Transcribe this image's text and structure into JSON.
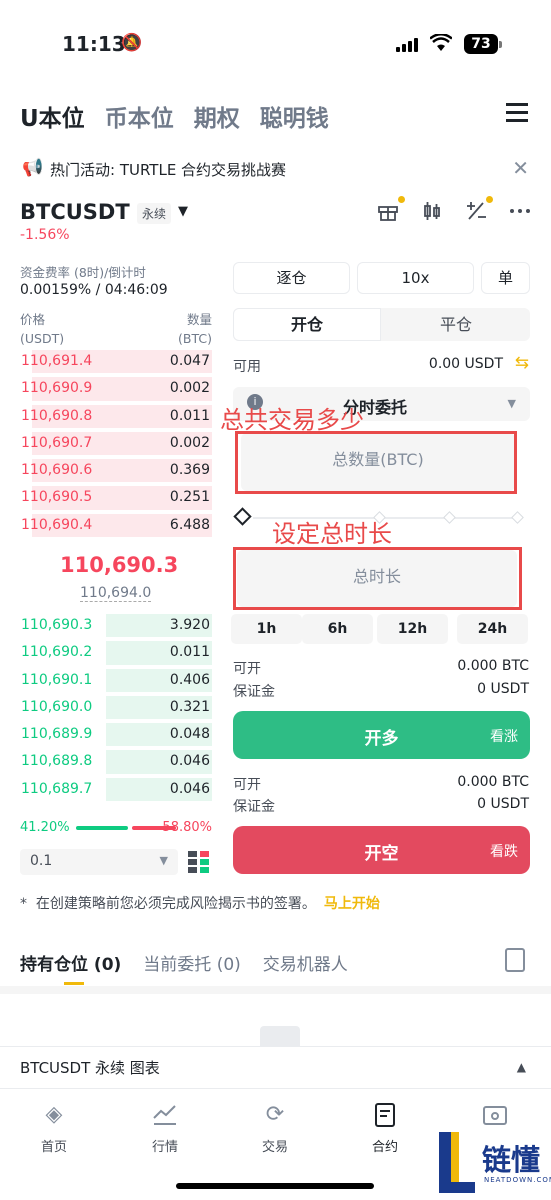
{
  "status": {
    "time": "11:13",
    "battery": "73"
  },
  "top_tabs": [
    "U本位",
    "币本位",
    "期权",
    "聪明钱"
  ],
  "banner": {
    "text": "热门活动: TURTLE 合约交易挑战赛"
  },
  "symbol": {
    "name": "BTCUSDT",
    "type": "永续",
    "change": "-1.56%"
  },
  "funding": {
    "label": "资金费率 (8时)/倒计时",
    "value": "0.00159% / 04:46:09"
  },
  "orderbook": {
    "price_header": [
      "价格",
      "(USDT)"
    ],
    "qty_header": [
      "数量",
      "(BTC)"
    ],
    "asks": [
      {
        "price": "110,691.4",
        "qty": "0.047",
        "depth": 0.85
      },
      {
        "price": "110,690.9",
        "qty": "0.002",
        "depth": 0.85
      },
      {
        "price": "110,690.8",
        "qty": "0.011",
        "depth": 0.85
      },
      {
        "price": "110,690.7",
        "qty": "0.002",
        "depth": 0.85
      },
      {
        "price": "110,690.6",
        "qty": "0.369",
        "depth": 0.85
      },
      {
        "price": "110,690.5",
        "qty": "0.251",
        "depth": 0.85
      },
      {
        "price": "110,690.4",
        "qty": "6.488",
        "depth": 0.85
      }
    ],
    "last_price": "110,690.3",
    "mark_price": "110,694.0",
    "bids": [
      {
        "price": "110,690.3",
        "qty": "3.920",
        "depth": 0.5
      },
      {
        "price": "110,690.2",
        "qty": "0.011",
        "depth": 0.5
      },
      {
        "price": "110,690.1",
        "qty": "0.406",
        "depth": 0.5
      },
      {
        "price": "110,690.0",
        "qty": "0.321",
        "depth": 0.5
      },
      {
        "price": "110,689.9",
        "qty": "0.048",
        "depth": 0.5
      },
      {
        "price": "110,689.8",
        "qty": "0.046",
        "depth": 0.5
      },
      {
        "price": "110,689.7",
        "qty": "0.046",
        "depth": 0.5
      }
    ],
    "buy_ratio": "41.20%",
    "sell_ratio": "58.80%",
    "step": "0.1"
  },
  "form": {
    "margin_mode": "逐仓",
    "leverage": "10x",
    "position_mode": "单",
    "open_label": "开仓",
    "close_label": "平仓",
    "available_label": "可用",
    "available_value": "0.00 USDT",
    "order_type": "分时委托",
    "total_qty_placeholder": "总数量(BTC)",
    "total_time_placeholder": "总时长",
    "durations": [
      "1h",
      "6h",
      "12h",
      "24h"
    ],
    "long": {
      "can_open_label": "可开",
      "can_open_value": "0.000 BTC",
      "margin_label": "保证金",
      "margin_value": "0 USDT",
      "button": "开多",
      "sub": "看涨"
    },
    "short": {
      "can_open_label": "可开",
      "can_open_value": "0.000 BTC",
      "margin_label": "保证金",
      "margin_value": "0 USDT",
      "button": "开空",
      "sub": "看跌"
    }
  },
  "annotations": {
    "a1": "总共交易多少",
    "a2": "设定总时长"
  },
  "note": {
    "text": "在创建策略前您必须完成风险揭示书的签署。",
    "link": "马上开始"
  },
  "bottom_tabs": [
    "持有仓位 (0)",
    "当前委托 (0)",
    "交易机器人"
  ],
  "chart_bar": "BTCUSDT 永续  图表",
  "nav": [
    "首页",
    "行情",
    "交易",
    "合约",
    ""
  ],
  "watermark": {
    "text": "链懂",
    "sub": "NEATDOWN.COM"
  },
  "colors": {
    "up": "#0ecb81",
    "down": "#f6465d",
    "accent": "#f0b90b",
    "annotation": "#e84a4a"
  }
}
